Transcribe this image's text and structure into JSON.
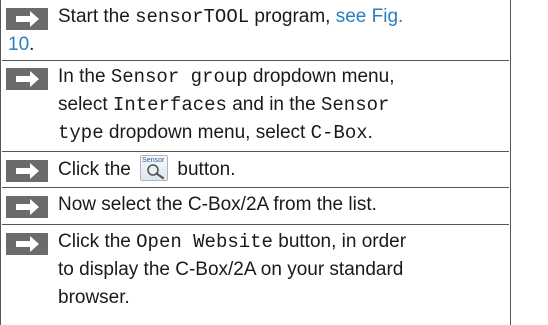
{
  "steps": [
    {
      "parts": [
        "Start the ",
        "sensorTOOL",
        " program, ",
        "see Fig.",
        "10",
        "."
      ]
    },
    {
      "line1": [
        "In the ",
        "Sensor group",
        " dropdown menu,"
      ],
      "line2": [
        "select ",
        "Interfaces",
        " and in the ",
        "Sensor"
      ],
      "line3": [
        "type",
        " dropdown menu, select ",
        "C-Box",
        "."
      ]
    },
    {
      "before": "Click the ",
      "icon_label": "Sensor",
      "after": " button."
    },
    {
      "text": "Now select the C-Box/2A from the list."
    },
    {
      "line1": [
        "Click the ",
        "Open Website",
        " button, in order"
      ],
      "line2": "to display the C-Box/2A on your standard",
      "line3": "browser."
    }
  ],
  "icons": {
    "step_marker": "arrow-right-icon",
    "sensor_button": "sensor-search-icon"
  },
  "colors": {
    "link": "#2a7fc1",
    "marker": "#6b6b6b",
    "border": "#555555"
  }
}
